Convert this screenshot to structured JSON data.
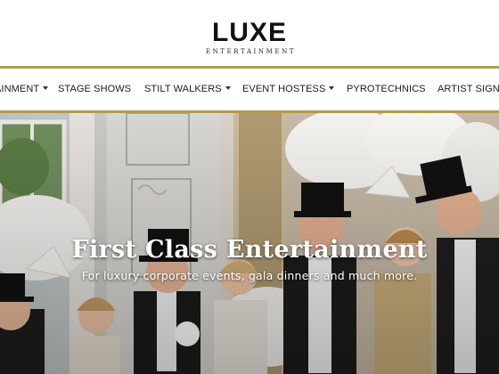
{
  "brand": {
    "name": "LUXE",
    "tagline": "ENTERTAINMENT"
  },
  "nav": {
    "items": [
      {
        "label": "AINMENT",
        "has_dropdown": true
      },
      {
        "label": "STAGE SHOWS",
        "has_dropdown": false
      },
      {
        "label": "STILT WALKERS",
        "has_dropdown": true
      },
      {
        "label": "EVENT HOSTESS",
        "has_dropdown": true
      },
      {
        "label": "PYROTECHNICS",
        "has_dropdown": false
      },
      {
        "label": "ARTIST SIGN UP",
        "has_dropdown": false
      }
    ]
  },
  "hero": {
    "title": "First Class Entertainment",
    "subtitle": "For luxury corporate events, gala dinners and much more."
  },
  "colors": {
    "accent_gold": "#b59a4d",
    "text_dark": "#1a1a1a"
  }
}
